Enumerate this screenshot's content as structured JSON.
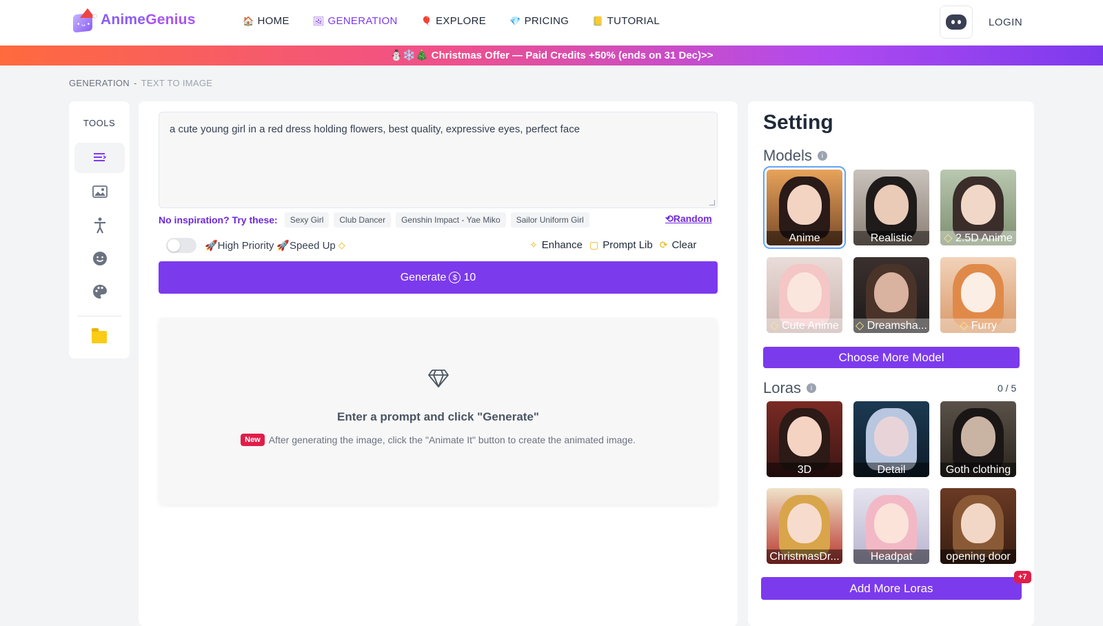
{
  "header": {
    "logo_text_a": "Anime",
    "logo_text_b": "Genius",
    "nav": [
      {
        "label": "HOME",
        "icon": "🏠"
      },
      {
        "label": "GENERATION",
        "icon": "🖼"
      },
      {
        "label": "EXPLORE",
        "icon": "🎈"
      },
      {
        "label": "PRICING",
        "icon": "💎"
      },
      {
        "label": "TUTORIAL",
        "icon": "📒"
      }
    ],
    "login": "LOGIN"
  },
  "banner": {
    "text": "⛄❄️🎄 Christmas Offer — Paid Credits +50% (ends on 31 Dec)>>"
  },
  "breadcrumb": {
    "parent": "GENERATION",
    "separator": "-",
    "current": "TEXT TO IMAGE"
  },
  "tools": {
    "title": "TOOLS"
  },
  "prompt": {
    "value": "a cute young girl in a red dress holding flowers, best quality, expressive eyes, perfect face",
    "inspiration_label": "No inspiration? Try these:",
    "suggestions": [
      "Sexy Girl",
      "Club Dancer",
      "Genshin Impact - Yae Miko",
      "Sailor Uniform Girl"
    ],
    "random": "Random"
  },
  "options": {
    "high_priority": "🚀High Priority",
    "speed_up": "🚀Speed Up",
    "enhance": "Enhance",
    "prompt_lib": "Prompt Lib",
    "clear": "Clear"
  },
  "generate": {
    "label": "Generate",
    "cost": "10",
    "coin_symbol": "$"
  },
  "result": {
    "title": "Enter a prompt and click \"Generate\"",
    "badge": "New",
    "note": "After generating the image, click the \"Animate It\" button to create the animated image."
  },
  "settings": {
    "title": "Setting",
    "models_title": "Models",
    "models": [
      {
        "label": "Anime",
        "premium": false,
        "selected": true
      },
      {
        "label": "Realistic",
        "premium": false,
        "selected": false
      },
      {
        "label": "2.5D Anime",
        "premium": true,
        "selected": false
      },
      {
        "label": "Cute Anime",
        "premium": true,
        "selected": false
      },
      {
        "label": "Dreamsha...",
        "premium": true,
        "selected": false
      },
      {
        "label": "Furry",
        "premium": true,
        "selected": false
      }
    ],
    "choose_more": "Choose More Model",
    "loras_title": "Loras",
    "loras_count": "0 / 5",
    "loras": [
      {
        "label": "3D"
      },
      {
        "label": "Detail"
      },
      {
        "label": "Goth clothing"
      },
      {
        "label": "ChristmasDr..."
      },
      {
        "label": "Headpat"
      },
      {
        "label": "opening door"
      }
    ],
    "add_more": "Add More Loras",
    "more_badge": "+7"
  },
  "colors": {
    "accent": "#7c3aed",
    "banner_start": "#ff6a3d",
    "banner_end": "#7c3aed",
    "badge": "#e11d48"
  }
}
